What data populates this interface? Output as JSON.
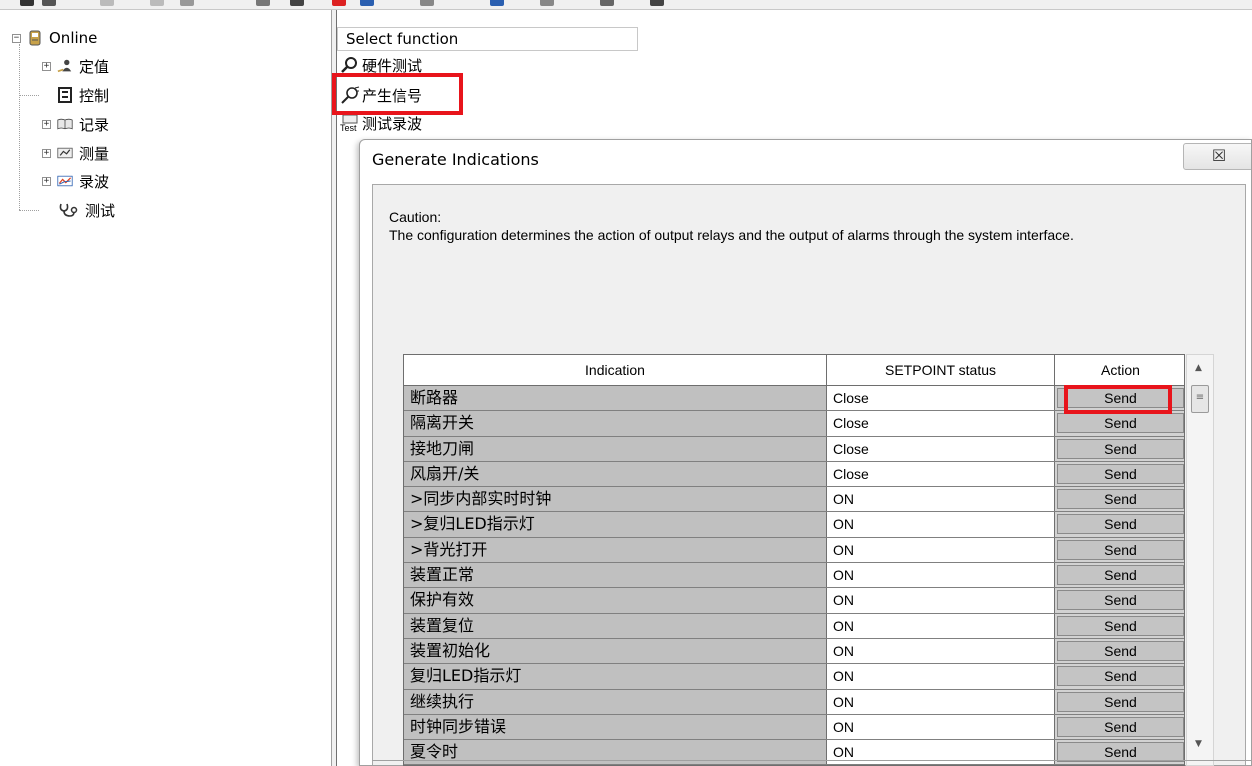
{
  "tree": {
    "root_label": "Online",
    "items": [
      {
        "label": "定值",
        "icon": "settings-person-icon"
      },
      {
        "label": "控制",
        "icon": "control-panel-icon"
      },
      {
        "label": "记录",
        "icon": "book-icon"
      },
      {
        "label": "测量",
        "icon": "meter-icon"
      },
      {
        "label": "录波",
        "icon": "waveform-chart-icon"
      },
      {
        "label": "测试",
        "icon": "stethoscope-icon"
      }
    ]
  },
  "select_function": {
    "header": "Select function",
    "items": [
      {
        "label": "硬件测试",
        "icon": "magnifier-icon"
      },
      {
        "label": "产生信号",
        "icon": "signal-probe-icon"
      },
      {
        "label": "测试录波",
        "icon": "test-icon",
        "icon_text": "Test"
      }
    ]
  },
  "dialog": {
    "title": "Generate Indications",
    "close_glyph": "☒",
    "caution_title": "Caution:",
    "caution_text": "The configuration determines the action of output relays and the output of alarms through the system interface.",
    "columns": [
      "Indication",
      "SETPOINT status",
      "Action"
    ],
    "rows": [
      {
        "indication": "断路器",
        "setpoint": "Close",
        "action": "Send"
      },
      {
        "indication": "隔离开关",
        "setpoint": "Close",
        "action": "Send"
      },
      {
        "indication": "接地刀闸",
        "setpoint": "Close",
        "action": "Send"
      },
      {
        "indication": "风扇开/关",
        "setpoint": "Close",
        "action": "Send"
      },
      {
        "indication": ">同步内部实时时钟",
        "setpoint": "ON",
        "action": "Send"
      },
      {
        "indication": ">复归LED指示灯",
        "setpoint": "ON",
        "action": "Send"
      },
      {
        "indication": ">背光打开",
        "setpoint": "ON",
        "action": "Send"
      },
      {
        "indication": "装置正常",
        "setpoint": "ON",
        "action": "Send"
      },
      {
        "indication": "保护有效",
        "setpoint": "ON",
        "action": "Send"
      },
      {
        "indication": "装置复位",
        "setpoint": "ON",
        "action": "Send"
      },
      {
        "indication": "装置初始化",
        "setpoint": "ON",
        "action": "Send"
      },
      {
        "indication": "复归LED指示灯",
        "setpoint": "ON",
        "action": "Send"
      },
      {
        "indication": "继续执行",
        "setpoint": "ON",
        "action": "Send"
      },
      {
        "indication": "时钟同步错误",
        "setpoint": "ON",
        "action": "Send"
      },
      {
        "indication": "夏令时",
        "setpoint": "ON",
        "action": "Send"
      }
    ]
  },
  "colors": {
    "highlight": "#e8141b",
    "indication_cell": "#c0c0c0",
    "action_button": "#c4c4c4",
    "dialog_body": "#f0f0f0"
  }
}
